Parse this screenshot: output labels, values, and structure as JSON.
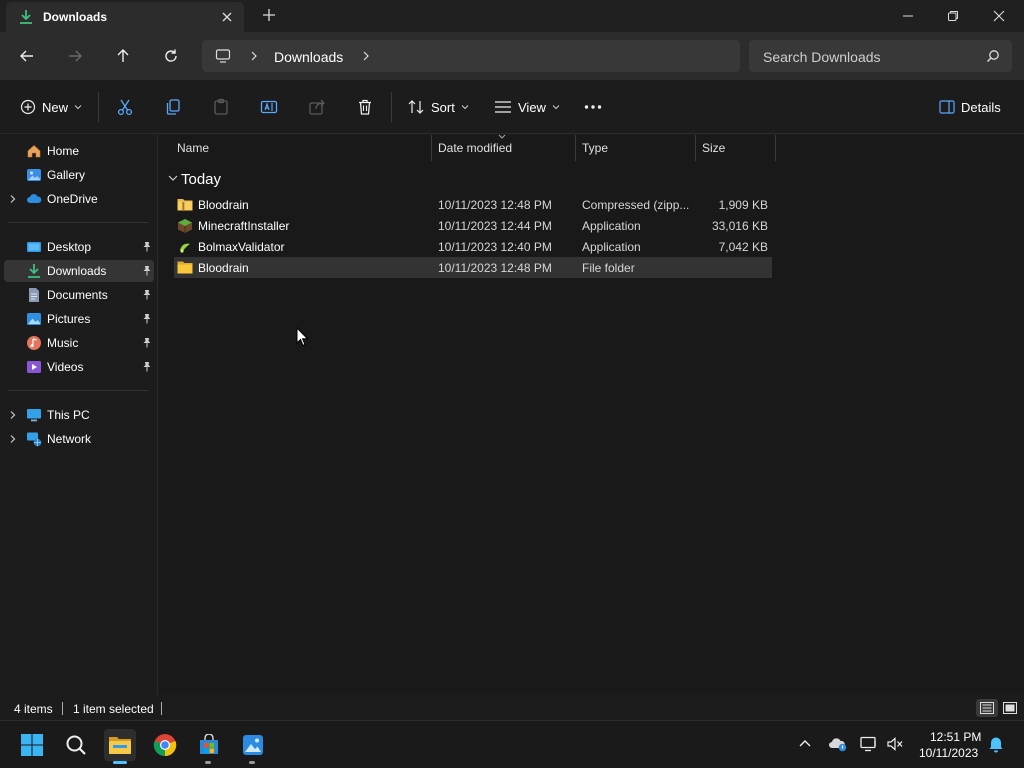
{
  "window": {
    "tab_title": "Downloads"
  },
  "navigation": {
    "breadcrumb": "Downloads",
    "search_placeholder": "Search Downloads"
  },
  "command_bar": {
    "new_label": "New",
    "sort_label": "Sort",
    "view_label": "View",
    "details_label": "Details"
  },
  "sidebar": {
    "home": "Home",
    "gallery": "Gallery",
    "onedrive": "OneDrive",
    "desktop": "Desktop",
    "downloads": "Downloads",
    "documents": "Documents",
    "pictures": "Pictures",
    "music": "Music",
    "videos": "Videos",
    "this_pc": "This PC",
    "network": "Network"
  },
  "file_list": {
    "columns": {
      "name": "Name",
      "date_modified": "Date modified",
      "type": "Type",
      "size": "Size"
    },
    "group_label": "Today",
    "rows": [
      {
        "name": "Bloodrain",
        "date": "10/11/2023 12:48 PM",
        "type": "Compressed (zipp...",
        "size": "1,909 KB",
        "icon": "zip-folder-icon"
      },
      {
        "name": "MinecraftInstaller",
        "date": "10/11/2023 12:44 PM",
        "type": "Application",
        "size": "33,016 KB",
        "icon": "minecraft-icon"
      },
      {
        "name": "BolmaxValidator",
        "date": "10/11/2023 12:40 PM",
        "type": "Application",
        "size": "7,042 KB",
        "icon": "app-icon"
      },
      {
        "name": "Bloodrain",
        "date": "10/11/2023 12:48 PM",
        "type": "File folder",
        "size": "",
        "icon": "folder-icon",
        "selected": true
      }
    ]
  },
  "status_bar": {
    "item_count": "4 items",
    "selection": "1 item selected"
  },
  "taskbar": {
    "time": "12:51 PM",
    "date": "10/11/2023"
  },
  "colors": {
    "accent": "#4cc2ff",
    "folder": "#f8c93d",
    "selection": "#333333"
  }
}
